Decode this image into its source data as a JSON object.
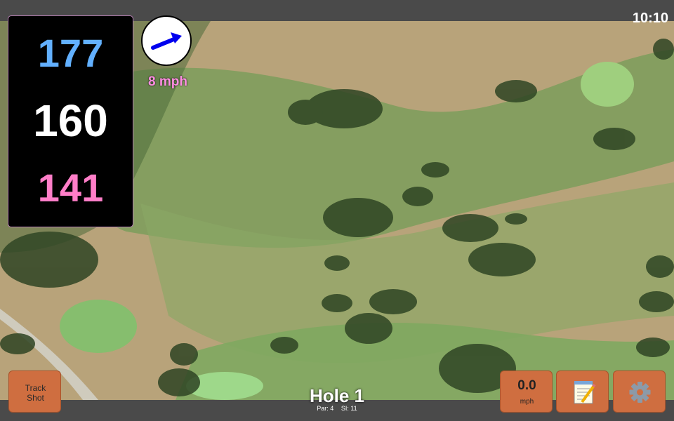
{
  "status_bar": {
    "time": "10:10"
  },
  "distances": {
    "back": "177",
    "middle": "160",
    "front": "141"
  },
  "wind": {
    "speed": "8 mph",
    "direction_icon": "arrow-icon",
    "arrow_color": "#0000ee"
  },
  "buttons": {
    "track_shot": "Track\nShot",
    "speed_value": "0.0",
    "speed_unit": "mph",
    "notes_icon": "notepad-icon",
    "settings_icon": "gear-icon"
  },
  "hole": {
    "title": "Hole 1",
    "par": "Par: 4",
    "si": "SI: 11"
  },
  "colors": {
    "back": "#62b0ff",
    "middle": "#ffffff",
    "front": "#ff7ec8",
    "button": "#cf6e40",
    "wind_text": "#ff8ee2"
  }
}
